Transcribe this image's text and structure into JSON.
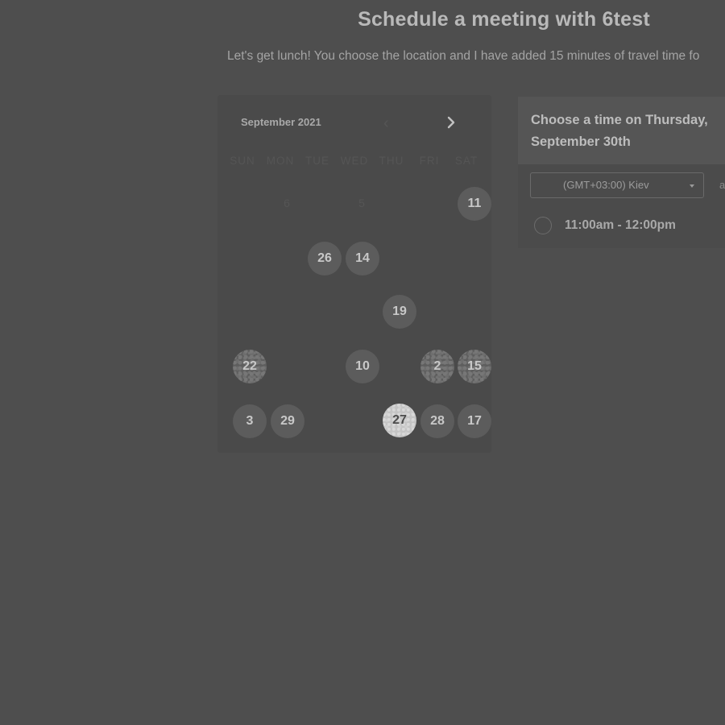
{
  "page": {
    "title": "Schedule a meeting with 6test",
    "description": "Let's get lunch! You choose the location and I have added 15 minutes of travel time fo"
  },
  "calendar": {
    "month_label": "September 2021",
    "prev_glyph": "‹",
    "next_glyph": "›",
    "weekdays": [
      "SUN",
      "MON",
      "TUE",
      "WED",
      "THU",
      "FRI",
      "SAT"
    ],
    "ghost_digits": [
      "6",
      "5"
    ],
    "available_days": [
      "11",
      "26",
      "14",
      "19",
      "22",
      "10",
      "2",
      "15",
      "3",
      "29",
      "27",
      "28",
      "17"
    ],
    "selected_day": "27"
  },
  "time_picker": {
    "heading": "Choose a time on Thursday, September 30th",
    "timezone": "(GMT+03:00) Kiev",
    "timezone_suffix": "a",
    "slots": [
      "11:00am - 12:00pm"
    ]
  },
  "icons": {
    "prev": "chevron-left-icon",
    "next": "chevron-right-icon",
    "dropdown": "caret-down-icon",
    "slot": "radio-circle-icon"
  },
  "colors": {
    "background": "#4e4e4e",
    "card": "#4a4a4a",
    "day_bubble": "#5c5c5c",
    "selected_day": "#c4c4c4"
  }
}
